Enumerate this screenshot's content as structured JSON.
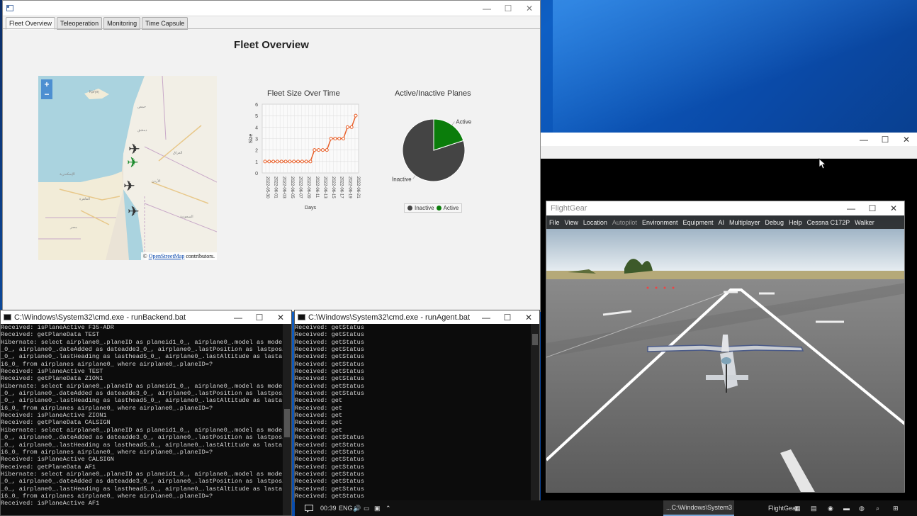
{
  "app": {
    "tabs": [
      "Fleet Overview",
      "Teleoperation",
      "Monitoring",
      "Time Capsule"
    ],
    "title": "Fleet Overview",
    "map": {
      "zoom_in": "+",
      "zoom_out": "−",
      "attribution_prefix": "©",
      "attribution_link": "OpenStreetMap",
      "attribution_suffix": "contributors."
    },
    "line_chart_title": "Fleet Size Over Time",
    "pie_chart_title": "Active/Inactive Planes"
  },
  "chart_data": [
    {
      "type": "line",
      "title": "Fleet Size Over Time",
      "xlabel": "Days",
      "ylabel": "Size",
      "ylim": [
        0,
        6
      ],
      "yticks": [
        "0",
        "1",
        "2",
        "3",
        "4",
        "5",
        "6"
      ],
      "xticks": [
        "2022-05-30",
        "2022-06-01",
        "2022-06-03",
        "2022-06-05",
        "2022-06-07",
        "2022-06-09",
        "2022-06-11",
        "2022-06-13",
        "2022-06-15",
        "2022-06-17",
        "2022-06-19",
        "2022-06-21"
      ],
      "grid": true,
      "color": "#e8602a",
      "y": [
        1,
        1,
        1,
        1,
        1,
        1,
        1,
        1,
        1,
        1,
        1,
        1,
        2,
        2,
        2,
        2,
        3,
        3,
        3,
        3,
        4,
        4,
        5
      ]
    },
    {
      "type": "pie",
      "title": "Active/Inactive Planes",
      "slices": [
        {
          "label": "Inactive",
          "value": 4,
          "color": "#444444"
        },
        {
          "label": "Active",
          "value": 1,
          "color": "#0b7d0b"
        }
      ],
      "legend": "bottom"
    }
  ],
  "win2": {
    "min": "—",
    "max": "☐",
    "close": "✕"
  },
  "cmd1": {
    "title": "C:\\Windows\\System32\\cmd.exe - runBackend.bat",
    "lines": [
      "Received: isPlaneActive F35-ADR",
      "Received: getPlaneData TEST",
      "Hibernate: select airplane0_.planeID as planeid1_0_, airplane0_.model as model2",
      "_0_, airplane0_.dateAdded as dateadde3_0_, airplane0_.lastPosition as lastposi4",
      "_0_, airplane0_.lastHeading as lasthead5_0_, airplane0_.lastAltitude as lastalt",
      "i6_0_ from airplanes airplane0_ where airplane0_.planeID=?",
      "Received: isPlaneActive TEST",
      "Received: getPlaneData ZION1",
      "Hibernate: select airplane0_.planeID as planeid1_0_, airplane0_.model as model2",
      "_0_, airplane0_.dateAdded as dateadde3_0_, airplane0_.lastPosition as lastposi4",
      "_0_, airplane0_.lastHeading as lasthead5_0_, airplane0_.lastAltitude as lastalt",
      "i6_0_ from airplanes airplane0_ where airplane0_.planeID=?",
      "Received: isPlaneActive ZION1",
      "Received: getPlaneData CALSIGN",
      "Hibernate: select airplane0_.planeID as planeid1_0_, airplane0_.model as model2",
      "_0_, airplane0_.dateAdded as dateadde3_0_, airplane0_.lastPosition as lastposi4",
      "_0_, airplane0_.lastHeading as lasthead5_0_, airplane0_.lastAltitude as lastalt",
      "i6_0_ from airplanes airplane0_ where airplane0_.planeID=?",
      "Received: isPlaneActive CALSIGN",
      "Received: getPlaneData AF1",
      "Hibernate: select airplane0_.planeID as planeid1_0_, airplane0_.model as model2",
      "_0_, airplane0_.dateAdded as dateadde3_0_, airplane0_.lastPosition as lastposi4",
      "_0_, airplane0_.lastHeading as lasthead5_0_, airplane0_.lastAltitude as lastalt",
      "i6_0_ from airplanes airplane0_ where airplane0_.planeID=?",
      "Received: isPlaneActive AF1"
    ]
  },
  "cmd2": {
    "title": "C:\\Windows\\System32\\cmd.exe - runAgent.bat",
    "lines": [
      "Received: getStatus",
      "Received: getStatus",
      "Received: getStatus",
      "Received: getStatus",
      "Received: getStatus",
      "Received: getStatus",
      "Received: getStatus",
      "Received: getStatus",
      "Received: getStatus",
      "Received: getStatus",
      "Received: get",
      "Received: get",
      "Received: get",
      "Received: get",
      "Received: get",
      "Received: getStatus",
      "Received: getStatus",
      "Received: getStatus",
      "Received: getStatus",
      "Received: getStatus",
      "Received: getStatus",
      "Received: getStatus",
      "Received: getStatus",
      "Received: getStatus"
    ]
  },
  "flightgear": {
    "title": "FlightGear",
    "menu": [
      "File",
      "View",
      "Location",
      "Autopilot",
      "Environment",
      "Equipment",
      "AI",
      "Multiplayer",
      "Debug",
      "Help",
      "Cessna C172P",
      "Walker"
    ]
  },
  "taskbar": {
    "time": "00:39",
    "lang": "ENG",
    "cmd_item": "...C:\\Windows\\System3",
    "fg_item": "FlightGear"
  }
}
